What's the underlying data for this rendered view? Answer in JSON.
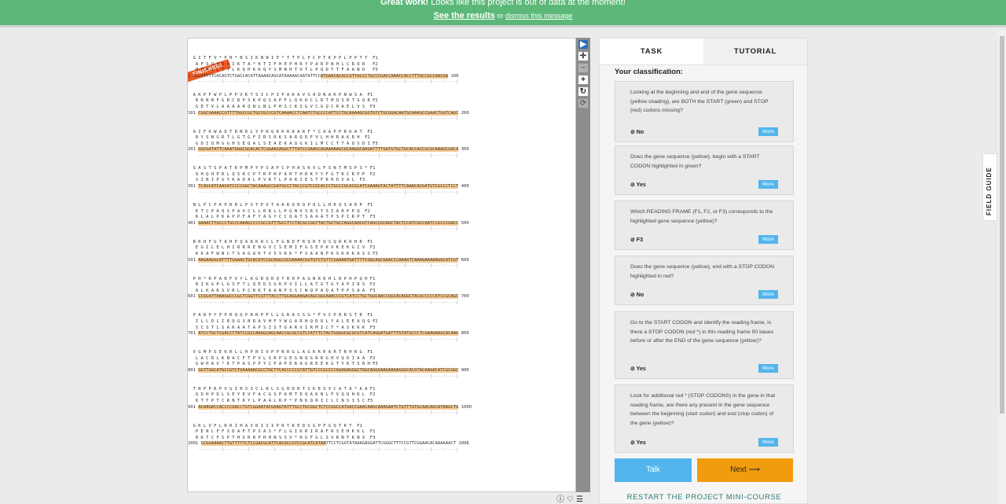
{
  "banner": {
    "strong": "Great work!",
    "message": " Looks like this project is out of data at the moment!",
    "results_link": "See the results",
    "or_text": " or ",
    "dismiss_link": "dismiss this message"
  },
  "subject": {
    "status_tag": "FINISHED!",
    "blocks": [
      {
        "f1": "  G I T F V * P H * N S I K N N I P * T T P L P C P T K P P L P P T T  F1",
        "f2": "   A F S Q S D H I K T A * K T I F H E P H R Y P A R P N H L C R Q R   F2",
        "f3": "   H F H S L T T L K Q H K K Q Y S M N H T V T L P Q D T T F A A N D   F3",
        "dna_pre": "1 GGCATTTTCACAGTCTGACCACATTAAAACAGCATAAAAACAATATTCC",
        "dna_hl": "ATGAACACACCGTTACCCTGCCCGACCAAACCACCTTTGCCGCCAACGA",
        "dna_post": " 100"
      },
      {
        "f1": "  A K P F W P L P P V K T S I C P I P A K A V S A D N A K P N W S A  F1",
        "f2": "   R R N R F G R C R P S K P Q S A P F L Q K R C L R T M Q S R T G Q R F2",
        "f3": "   G E T V L A A A A R Q N L N L P H S C K S G V C G Q C K A E L V S  F3",
        "dna_pre": "101 ",
        "dna_hl": "CGGCGAAACCGTTTTGGCCGCTGCCGCCCGTCAAAACCTCAATCTGCCCCATTCCTGCAAAAGCGGTGTCTGCGGACAATGCAAAGCCGAACTGGTCAGC",
        "dna_post": " 200"
      },
      {
        "f1": "  A I F K W A D T R N R L Y P K Q K K R K A R F * C A A P P R K A T  F1",
        "f2": "   R Y S N G R T L G T G F I R S R K S A R Q D F V L H H R A K R H  F2",
        "f3": "   G D I Q M G G H S E Q A L S E A E K A Q G K I L M C C T T A Q S D I F3",
        "dna_pre": "201 ",
        "dna_hl": "GGCGATATTCAAATGGGCGGACACTCGGAACAGGCTTTATCCGAAGCAGAAAAAGCGCAAGGCAAGATTTTGATGTGCTGCACCACCGCGCAAAGCGACA",
        "dna_post": " 300"
      },
      {
        "f1": "  S A S T S P A T K P M P Y P S A P C P H A S K V L F S N T M S P S * F1",
        "f2": "   Q H Q H P R L Q S R C P T R P H P A R T H R K Y Y F G T R C R P P  F2",
        "f3": "   S I N I P G Y K A D A L P V R T L P A R I E S T F K H D V A L  F3",
        "dna_pre": "301 ",
        "dna_hl": "TCAGCATCAACATCCCCGGCTACAAAGCCGATGCCCTACCCGTCCGCACCCTGCCCGCACGCATCGAAAGTACTATTTTCAAACACGATGTCGCCCTCCT",
        "dna_post": " 400"
      },
      {
        "f1": "  N L P C P K P R R L P S T P V T A A R Q R Q P Q L L H R Q S A R P  F1",
        "f2": "   E T C P A Q S P A V C L L R R L L P G N V S R S Y S I A R P P Q  F2",
        "f3": "   K L A L P K A P P F A F Y A G Y C C Q A T S A A A T P S P I R P T  F3",
        "dna_pre": "401 ",
        "dna_hl": "GAAACTTGCCCTGCCCAAAGCCCCGCCGTTTGCCTTCTACGCCGGTTACTGCTGCCAGGCAACGTCAGCCGCAGCTACTCCATCGCCAATCCGCCCGACC",
        "dna_post": " 500"
      },
      {
        "f1": "  R R H F G T A H P Q A R K R C L F G N D F R Q R T Q S Q R K R H R  F1",
        "f2": "   E G I L E L H I R R R E N G V C S E M I F G S E P K V K E K G I V  F2",
        "f3": "   K K A F W N C T S A G A K T V S V R K * F S A A N P K S K K K A S S F3",
        "dna_pre": "501 ",
        "dna_hl": "AAGAAGGCATTTTGGAACTGCACATCCGCAGGCGCGAAAACGGTGTCTGTTCGGAAATGATTTTCGGCAGCGAACCCAAAGTCAAAGAAAAAGGCATCGT",
        "dna_post": " 600"
      },
      {
        "f1": "  P H * R P A R F V Y L A G R Q R Q T R H P A G N R R H L R P H P Q H F1",
        "f2": "   R I K G P L G S F T L Q E D S G K P V I L L A T G T G Y A P I R S  F2",
        "f3": "   A L K A R S V R L P C R K T A A N P S S C W Q P A Q A T P P S A A  F3",
        "dna_pre": "601 ",
        "dna_hl": "CCGCATTAAAGGCCCGCTCGGTTCGTTTACCTTGCAGGAAGACAGCGGCAAACCCGTCATCCTGCTGGCAACCGGCACAGGCTACGCCCCCATCCGCAGC",
        "dna_post": " 700"
      },
      {
        "f1": "  P A R P Y P P R Q Q P R R P F L L G R A S S G * F V C P R R S T R  F1",
        "f2": "   I L L D L I R Q G S N R A V H F Y W G A R H Q D D L Y A L E E A Q G F2",
        "f3": "   S C S T L S A K A A T A P S I S T G A R V I R M I C T * A S K K K  F3",
        "dna_pre": "701 ",
        "dna_hl": "ATCCTGCTCGACCTTATCCGCCAAGGCAGCAACCGCGCCGTCCATTTCTACTGGGGCGCGCGTCATCAGGATGATTTGTATGCCCTCGAAGAAGCACAAG",
        "dna_post": " 800"
      },
      {
        "f1": "  V G M P S E K R L L H P R I V P P R R G L A G K K R A R T R H R G  F1",
        "f2": "   L A C R L K N A C F T P V L S R P G E G N Q G R K G H V Q D I A A  F2",
        "f3": "   G W H A V * K T P A S P P Y C P A P E R A G R E E K G T Y K T S R H F3",
        "dna_pre": "801 ",
        "dna_hl": "GGTTGGCATGCCGTCTGAAAAACGCCTGCTTCACCCCCGTATTGTCCCGCCCCGGAGAGGGCTGGCAGGGAAGAAAAGGGCACGTACAAGACATCGCGGC",
        "dna_post": " 900"
      },
      {
        "f1": "  T R P P R P V G I R S I C L R L S G H D R T S K E S V C A T A * A A F1",
        "f2": "   Q D H P D L S E Y E V F A C G S P A M T E Q A K N L F V Q Q H K L  F2",
        "f3": "   K T T P T C R N T K Y L P A A L R P * P N K Q R I C L C N S I S C F3",
        "dna_pre": "901 ",
        "dna_hl": "ACAAGACCACCCCGACCTGTCGGAATACGAAGTATTTGCCTGCGGCTCTCCGGCCATGACCGAACAAGCAAAGAATCTGTTTGTGCAACAGCATAAGCTG",
        "dna_post": " 1000"
      },
      {
        "f1": "  G K L V F L R R I H A V R I I I P R Y K E D S G P F G Q T K T  F1",
        "f2": "   P E N L F F S D A F T P S A S * F L G I K R I R A F R S E H K K L  F2",
        "f3": "   R K T C F S P T H S R R P H H N S S V * R G F G L S V R N T K N X  F3",
        "dna_pre": "1001 ",
        "dna_hl": "CCGGAAAACTTGTTTTTCTCCGACGCATTCACGCCGTCCGCATCATAA",
        "dna_post": "TTCCTCGGTATAAAGAGGATTCGGGCTTTCCGTTCGGAACACAAAAAACT 1098"
      }
    ]
  },
  "meta_icons": [
    "info-icon",
    "heart-icon",
    "list-icon"
  ],
  "tools": {
    "pointer": "▶",
    "move": "✛",
    "zoom_out": "−",
    "zoom_in": "+",
    "rotate": "↻",
    "reset": "⟳"
  },
  "panel": {
    "tabs": [
      "TASK",
      "TUTORIAL"
    ],
    "your_classification": "Your classification:",
    "questions": [
      {
        "text": "Looking at the beginning and end of the gene sequence (yellow shading), are BOTH the START (green) and STOP (red) codons missing?",
        "answer": "⊘ No",
        "more": "More"
      },
      {
        "text": "Does the gene sequence (yellow), begin with a START CODON highlighted in green?",
        "answer": "⊘ Yes",
        "more": "More"
      },
      {
        "text": "Which READING FRAME (F1, F2, or F3) corresponds to the highlighted gene sequence (yellow)?",
        "answer": "⊘ F3",
        "more": "More"
      },
      {
        "text": "Does the gene sequence (yellow), end with a STOP CODON highlighted in red?",
        "answer": "⊘ No",
        "more": "More"
      },
      {
        "text": "Go to the START CODON and identify the reading frame, is there a STOP CODON (red *) in this reading frame 50 bases before or after the END of the gene sequence (yellow)?",
        "answer": "⊘ Yes",
        "more": "More"
      },
      {
        "text": "Look for additional red * (STOP CODONS) in the gene in that reading frame, are there any present in the gene sequence between the beginning (start codon) and end (stop codon) of the gene (yellow)?",
        "answer": "⊘ Yes",
        "more": "More"
      }
    ],
    "talk_button": "Talk",
    "next_button": "Next ⟶",
    "restart_link": "RESTART THE PROJECT MINI-COURSE"
  },
  "field_guide": "FIELD GUIDE",
  "colors": {
    "banner": "#5cb879",
    "gene_highlight": "#f6c98f",
    "start_codon": "#3aa79b",
    "stop_codon": "#f2776f",
    "talk": "#52b5ec",
    "next": "#f19c0e",
    "finished_tag": "#ee5a24"
  }
}
